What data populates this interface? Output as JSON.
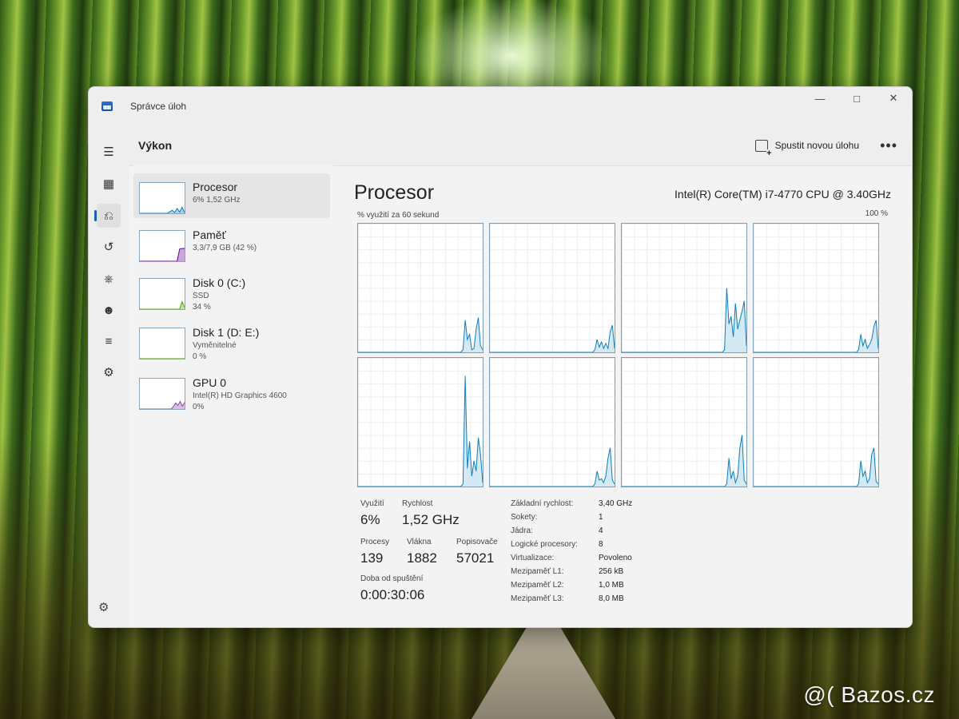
{
  "window": {
    "title": "Správce úloh"
  },
  "header": {
    "section": "Výkon",
    "run_task": "Spustit novou úlohu",
    "more": "•••"
  },
  "rail": [
    "menu-icon",
    "processes-icon",
    "performance-icon",
    "history-icon",
    "startup-icon",
    "users-icon",
    "details-icon",
    "services-icon"
  ],
  "devices": [
    {
      "name": "Procesor",
      "sub": "6% 1,52 GHz",
      "sub2": "",
      "active": true,
      "thumb": [
        0,
        0,
        0,
        0,
        0,
        0,
        0,
        0,
        0,
        0,
        0,
        0,
        5,
        10,
        3,
        16,
        4,
        20,
        2
      ],
      "color": "#117dbb"
    },
    {
      "name": "Paměť",
      "sub": "3,3/7,9 GB (42 %)",
      "sub2": "",
      "active": false,
      "thumb": [
        0,
        0,
        0,
        0,
        0,
        0,
        0,
        0,
        0,
        0,
        0,
        0,
        0,
        0,
        0,
        0,
        40,
        42,
        42
      ],
      "color": "#660099"
    },
    {
      "name": "Disk 0 (C:)",
      "sub": "SSD",
      "sub2": "34 %",
      "active": false,
      "thumb": [
        0,
        0,
        0,
        0,
        0,
        0,
        0,
        0,
        0,
        0,
        0,
        0,
        0,
        0,
        0,
        0,
        0,
        25,
        6
      ],
      "color": "#4da60c"
    },
    {
      "name": "Disk 1 (D: E:)",
      "sub": "Vyměnitelné",
      "sub2": "0 %",
      "active": false,
      "thumb": [
        0,
        0,
        0
      ],
      "color": "#4da60c"
    },
    {
      "name": "GPU 0",
      "sub": "Intel(R) HD Graphics 4600",
      "sub2": "0%",
      "active": false,
      "thumb": [
        0,
        0,
        0,
        0,
        0,
        0,
        0,
        0,
        0,
        0,
        0,
        0,
        0,
        0,
        0,
        8,
        20,
        12,
        25,
        10,
        22
      ],
      "color": "#8e44ad"
    }
  ],
  "main": {
    "title": "Procesor",
    "cpu_model": "Intel(R) Core(TM) i7-4770 CPU @ 3.40GHz",
    "util_label": "% využití za 60 sekund",
    "util_max": "100 %"
  },
  "chart_data": {
    "type": "area",
    "title": "",
    "xlabel": "% využití za 60 sekund",
    "ylabel": "",
    "ylim": [
      0,
      100
    ],
    "series": [
      {
        "values": [
          0,
          0,
          0,
          0,
          0,
          0,
          0,
          0,
          0,
          0,
          0,
          0,
          0,
          0,
          0,
          0,
          0,
          0,
          0,
          0,
          0,
          0,
          0,
          0,
          0,
          0,
          0,
          0,
          0,
          0,
          0,
          0,
          0,
          0,
          0,
          0,
          0,
          0,
          0,
          0,
          0,
          0,
          0,
          0,
          0,
          0,
          0,
          0,
          2,
          25,
          10,
          14,
          2,
          3,
          18,
          27,
          5,
          2
        ]
      },
      {
        "values": [
          0,
          0,
          0,
          0,
          0,
          0,
          0,
          0,
          0,
          0,
          0,
          0,
          0,
          0,
          0,
          0,
          0,
          0,
          0,
          0,
          0,
          0,
          0,
          0,
          0,
          0,
          0,
          0,
          0,
          0,
          0,
          0,
          0,
          0,
          0,
          0,
          0,
          0,
          0,
          0,
          0,
          0,
          0,
          0,
          0,
          0,
          0,
          0,
          2,
          10,
          4,
          8,
          3,
          7,
          3,
          16,
          21,
          3
        ]
      },
      {
        "values": [
          0,
          0,
          0,
          0,
          0,
          0,
          0,
          0,
          0,
          0,
          0,
          0,
          0,
          0,
          0,
          0,
          0,
          0,
          0,
          0,
          0,
          0,
          0,
          0,
          0,
          0,
          0,
          0,
          0,
          0,
          0,
          0,
          0,
          0,
          0,
          0,
          0,
          0,
          0,
          0,
          0,
          0,
          0,
          0,
          0,
          0,
          0,
          2,
          50,
          22,
          28,
          12,
          38,
          18,
          25,
          32,
          40,
          5
        ]
      },
      {
        "values": [
          0,
          0,
          0,
          0,
          0,
          0,
          0,
          0,
          0,
          0,
          0,
          0,
          0,
          0,
          0,
          0,
          0,
          0,
          0,
          0,
          0,
          0,
          0,
          0,
          0,
          0,
          0,
          0,
          0,
          0,
          0,
          0,
          0,
          0,
          0,
          0,
          0,
          0,
          0,
          0,
          0,
          0,
          0,
          0,
          0,
          0,
          0,
          0,
          2,
          14,
          5,
          10,
          3,
          6,
          10,
          20,
          25,
          3
        ]
      },
      {
        "values": [
          0,
          0,
          0,
          0,
          0,
          0,
          0,
          0,
          0,
          0,
          0,
          0,
          0,
          0,
          0,
          0,
          0,
          0,
          0,
          0,
          0,
          0,
          0,
          0,
          0,
          0,
          0,
          0,
          0,
          0,
          0,
          0,
          0,
          0,
          0,
          0,
          0,
          0,
          0,
          0,
          0,
          0,
          0,
          0,
          0,
          0,
          0,
          0,
          2,
          86,
          14,
          35,
          8,
          20,
          12,
          38,
          25,
          3
        ]
      },
      {
        "values": [
          0,
          0,
          0,
          0,
          0,
          0,
          0,
          0,
          0,
          0,
          0,
          0,
          0,
          0,
          0,
          0,
          0,
          0,
          0,
          0,
          0,
          0,
          0,
          0,
          0,
          0,
          0,
          0,
          0,
          0,
          0,
          0,
          0,
          0,
          0,
          0,
          0,
          0,
          0,
          0,
          0,
          0,
          0,
          0,
          0,
          0,
          0,
          0,
          2,
          12,
          5,
          6,
          3,
          8,
          22,
          30,
          5,
          2
        ]
      },
      {
        "values": [
          0,
          0,
          0,
          0,
          0,
          0,
          0,
          0,
          0,
          0,
          0,
          0,
          0,
          0,
          0,
          0,
          0,
          0,
          0,
          0,
          0,
          0,
          0,
          0,
          0,
          0,
          0,
          0,
          0,
          0,
          0,
          0,
          0,
          0,
          0,
          0,
          0,
          0,
          0,
          0,
          0,
          0,
          0,
          0,
          0,
          0,
          0,
          0,
          2,
          22,
          6,
          12,
          3,
          8,
          30,
          40,
          5,
          2
        ]
      },
      {
        "values": [
          0,
          0,
          0,
          0,
          0,
          0,
          0,
          0,
          0,
          0,
          0,
          0,
          0,
          0,
          0,
          0,
          0,
          0,
          0,
          0,
          0,
          0,
          0,
          0,
          0,
          0,
          0,
          0,
          0,
          0,
          0,
          0,
          0,
          0,
          0,
          0,
          0,
          0,
          0,
          0,
          0,
          0,
          0,
          0,
          0,
          0,
          0,
          0,
          2,
          20,
          8,
          12,
          3,
          6,
          25,
          30,
          4,
          2
        ]
      }
    ]
  },
  "stats": {
    "util_label": "Využití",
    "util_value": "6%",
    "speed_label": "Rychlost",
    "speed_value": "1,52 GHz",
    "proc_label": "Procesy",
    "proc_value": "139",
    "threads_label": "Vlákna",
    "threads_value": "1882",
    "handles_label": "Popisovače",
    "handles_value": "57021",
    "uptime_label": "Doba od spuštění",
    "uptime_value": "0:00:30:06"
  },
  "details": [
    {
      "k": "Základní rychlost:",
      "v": "3,40 GHz"
    },
    {
      "k": "Sokety:",
      "v": "1"
    },
    {
      "k": "Jádra:",
      "v": "4"
    },
    {
      "k": "Logické procesory:",
      "v": "8"
    },
    {
      "k": "Virtualizace:",
      "v": "Povoleno"
    },
    {
      "k": "Mezipaměť L1:",
      "v": "256 kB"
    },
    {
      "k": "Mezipaměť L2:",
      "v": "1,0 MB"
    },
    {
      "k": "Mezipaměť L3:",
      "v": "8,0 MB"
    }
  ],
  "watermark": "@( Bazos.cz",
  "colors": {
    "cpu_line": "#117dbb",
    "cpu_fill": "#d3e9f4"
  }
}
